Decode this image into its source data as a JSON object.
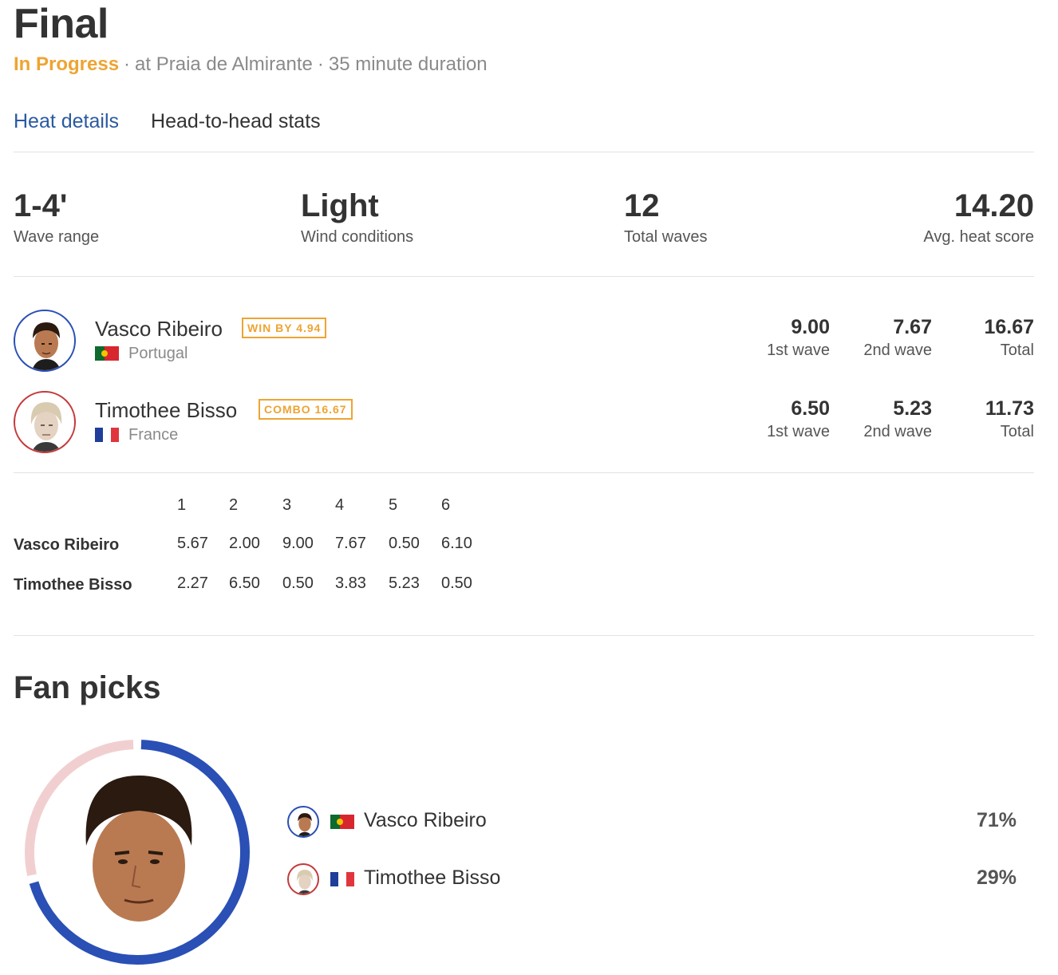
{
  "heat": {
    "title": "Final",
    "status": "In Progress",
    "location": "at Praia de Almirante",
    "duration": "35 minute duration"
  },
  "tabs": [
    {
      "label": "Heat details",
      "active": true
    },
    {
      "label": "Head-to-head stats",
      "active": false
    }
  ],
  "conditions": [
    {
      "value": "1-4'",
      "label": "Wave range"
    },
    {
      "value": "Light",
      "label": "Wind conditions"
    },
    {
      "value": "12",
      "label": "Total waves"
    },
    {
      "value": "14.20",
      "label": "Avg. heat score"
    }
  ],
  "surfers": [
    {
      "name": "Vasco Ribeiro",
      "badge": "WIN BY 4.94",
      "country": "Portugal",
      "wave1": "9.00",
      "wave1_label": "1st wave",
      "wave2": "7.67",
      "wave2_label": "2nd wave",
      "total": "16.67",
      "total_label": "Total",
      "ring_color": "#2a4fb5"
    },
    {
      "name": "Timothee Bisso",
      "badge": "COMBO 16.67",
      "country": "France",
      "wave1": "6.50",
      "wave1_label": "1st wave",
      "wave2": "5.23",
      "wave2_label": "2nd wave",
      "total": "11.73",
      "total_label": "Total",
      "ring_color": "#c53a3a"
    }
  ],
  "wave_table": {
    "headers": [
      "1",
      "2",
      "3",
      "4",
      "5",
      "6"
    ],
    "rows": [
      {
        "name": "Vasco Ribeiro",
        "scores": [
          "5.67",
          "2.00",
          "9.00",
          "7.67",
          "0.50",
          "6.10"
        ],
        "counted": [
          false,
          false,
          true,
          true,
          false,
          false
        ]
      },
      {
        "name": "Timothee Bisso",
        "scores": [
          "2.27",
          "6.50",
          "0.50",
          "3.83",
          "5.23",
          "0.50"
        ],
        "counted": [
          false,
          true,
          false,
          false,
          true,
          false
        ]
      }
    ]
  },
  "fan_picks": {
    "title": "Fan picks",
    "entries": [
      {
        "name": "Vasco Ribeiro",
        "percent": "71%",
        "share": 0.71,
        "color": "#2a4fb5"
      },
      {
        "name": "Timothee Bisso",
        "percent": "29%",
        "share": 0.29,
        "color": "#f1cfd0"
      }
    ]
  },
  "colors": {
    "accent_orange": "#eea432",
    "link_blue": "#2a5aa0",
    "vasco_blue": "#2a4fb5",
    "timothee_red": "#c53a3a"
  }
}
